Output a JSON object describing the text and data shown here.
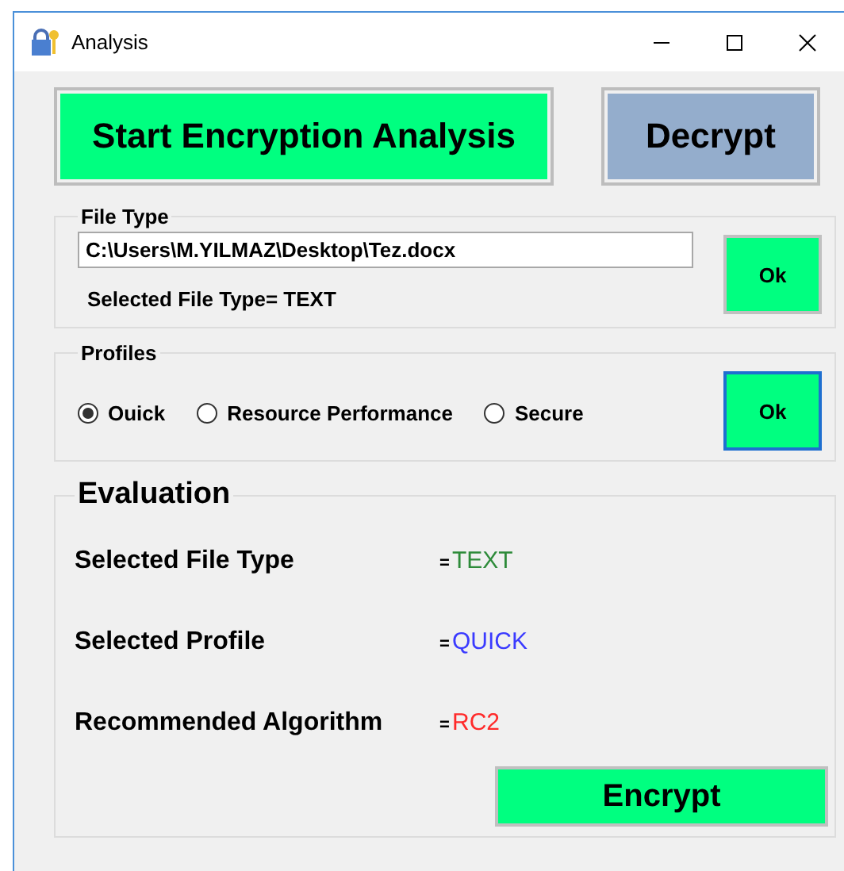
{
  "window": {
    "title": "Analysis"
  },
  "top_buttons": [
    {
      "label": "Start Encryption Analysis",
      "kind": "primary"
    },
    {
      "label": "Decrypt",
      "kind": "secondary"
    }
  ],
  "file_type": {
    "title": "File Type",
    "path": "C:\\Users\\M.YILMAZ\\Desktop\\Tez.docx",
    "selected_text": "Selected File Type= TEXT",
    "ok": {
      "label": "Ok",
      "focused": false
    }
  },
  "profiles": {
    "title": "Profiles",
    "options": [
      {
        "label": "Ouick",
        "selected": true
      },
      {
        "label": "Resource Performance",
        "selected": false
      },
      {
        "label": "Secure",
        "selected": false
      }
    ],
    "ok": {
      "label": "Ok",
      "focused": true
    }
  },
  "evaluation": {
    "title": "Evaluation",
    "rows": [
      {
        "label": "Selected File Type",
        "separator": "=",
        "value": "TEXT",
        "color": "#2e8b3a"
      },
      {
        "label": "Selected Profile",
        "separator": "=",
        "value": "QUICK",
        "color": "#3a3aff"
      },
      {
        "label": "Recommended Algorithm",
        "separator": "=",
        "value": "RC2",
        "color": "#ff2a2a"
      }
    ],
    "encrypt": "Encrypt"
  }
}
